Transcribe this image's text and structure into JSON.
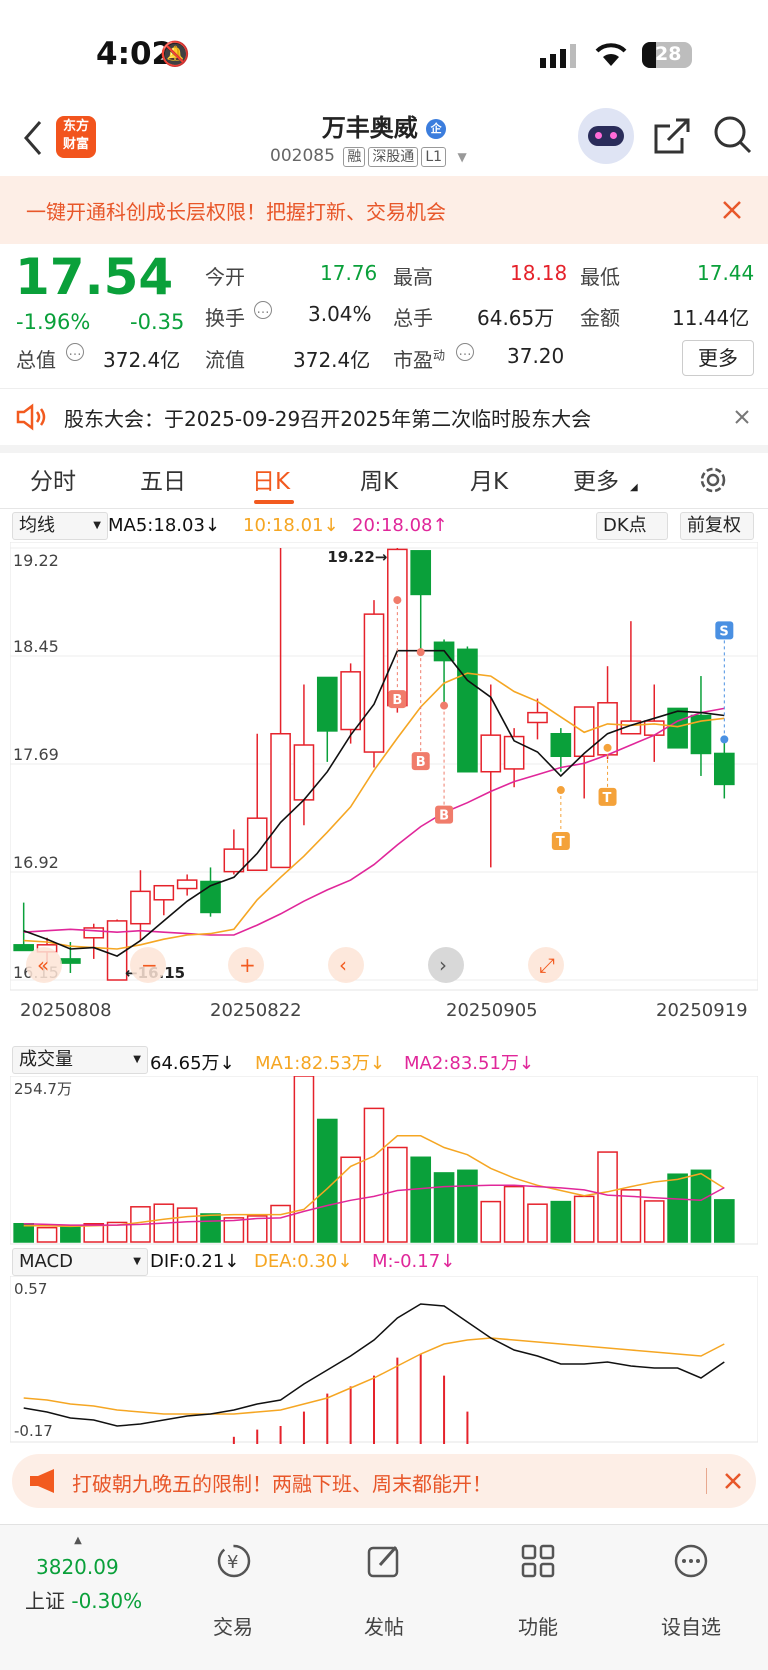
{
  "status_bar": {
    "time": "4:02",
    "battery": "28"
  },
  "header": {
    "title": "万丰奥威",
    "badge": "企",
    "code": "002085",
    "tags": [
      "融",
      "深股通",
      "L1"
    ],
    "logo_line1": "东方",
    "logo_line2": "财富"
  },
  "promo_banner": {
    "text": "一键开通科创成长层权限！把握打新、交易机会"
  },
  "quote": {
    "price": "17.54",
    "change_pct": "-1.96%",
    "change": "-0.35",
    "open_label": "今开",
    "open": "17.76",
    "high_label": "最高",
    "high": "18.18",
    "low_label": "最低",
    "low": "17.44",
    "turnover_label": "换手",
    "turnover": "3.04%",
    "volume_label": "总手",
    "volume": "64.65万",
    "amount_label": "金额",
    "amount": "11.44亿",
    "mcap_label": "总值",
    "mcap": "372.4亿",
    "float_label": "流值",
    "float": "372.4亿",
    "pe_label": "市盈",
    "pe_sup": "动",
    "pe": "37.20",
    "more": "更多"
  },
  "notice": {
    "text": "股东大会：于2025-09-29召开2025年第二次临时股东大会"
  },
  "tabs": [
    "分时",
    "五日",
    "日K",
    "周K",
    "月K",
    "更多"
  ],
  "active_tab": 2,
  "kline": {
    "ma_selector": "均线",
    "ma5": "MA5:18.03",
    "ma10": "10:18.01",
    "ma20": "20:18.08",
    "dk": "DK点",
    "fq": "前复权",
    "price_labels": [
      "19.22",
      "18.45",
      "17.69",
      "16.92",
      "16.15"
    ],
    "high_annot": "19.22",
    "low_annot": "16.15",
    "dates": [
      "20250808",
      "20250822",
      "20250905",
      "20250919"
    ],
    "signals": {
      "buy": "B",
      "sell": "S",
      "t": "T"
    }
  },
  "volume": {
    "selector": "成交量",
    "value": "64.65万",
    "ma1": "MA1:82.53万",
    "ma2": "MA2:83.51万",
    "max_label": "254.7万"
  },
  "macd": {
    "selector": "MACD",
    "dif": "DIF:0.21",
    "dea": "DEA:0.30",
    "m": "M:-0.17",
    "top_label": "0.57",
    "bottom_label": "-0.17"
  },
  "chart_data": {
    "type": "candlestick",
    "x": [
      "0808",
      "0811",
      "0812",
      "0813",
      "0814",
      "0815",
      "0818",
      "0819",
      "0820",
      "0821",
      "0822",
      "0825",
      "0826",
      "0827",
      "0828",
      "0829",
      "0901",
      "0902",
      "0903",
      "0904",
      "0905",
      "0908",
      "0909",
      "0910",
      "0911",
      "0912",
      "0915",
      "0916",
      "0917",
      "0918",
      "0919"
    ],
    "open": [
      16.4,
      16.35,
      16.3,
      16.45,
      16.15,
      16.55,
      16.72,
      16.8,
      16.85,
      16.92,
      16.93,
      16.95,
      17.43,
      18.3,
      17.93,
      17.77,
      18.1,
      19.2,
      18.55,
      18.5,
      17.63,
      17.65,
      17.98,
      17.9,
      17.74,
      17.75,
      17.9,
      17.89,
      18.08,
      18.03,
      17.76
    ],
    "close": [
      16.36,
      16.4,
      16.27,
      16.52,
      16.57,
      16.78,
      16.82,
      16.86,
      16.63,
      17.08,
      17.3,
      17.9,
      17.82,
      17.92,
      18.34,
      18.75,
      19.21,
      18.89,
      18.42,
      17.63,
      17.89,
      17.88,
      18.05,
      17.74,
      18.09,
      18.12,
      17.99,
      17.99,
      17.8,
      17.76,
      17.54
    ],
    "high": [
      16.7,
      16.45,
      16.42,
      16.55,
      16.58,
      16.93,
      16.82,
      16.9,
      16.95,
      17.22,
      17.9,
      19.22,
      18.25,
      18.18,
      18.4,
      18.85,
      19.22,
      19.08,
      18.57,
      18.52,
      18.25,
      17.94,
      18.15,
      17.94,
      18.05,
      18.38,
      18.7,
      18.25,
      18.05,
      18.31,
      17.86
    ],
    "low": [
      16.36,
      16.28,
      16.2,
      16.3,
      16.15,
      16.43,
      16.61,
      16.75,
      16.6,
      16.9,
      16.93,
      16.95,
      17.25,
      17.7,
      17.83,
      17.66,
      18.05,
      18.48,
      18.1,
      17.63,
      16.95,
      17.52,
      17.86,
      17.63,
      17.44,
      17.72,
      17.91,
      17.7,
      17.8,
      17.6,
      17.44
    ],
    "ma5": [
      16.5,
      16.44,
      16.37,
      16.38,
      16.32,
      16.43,
      16.57,
      16.71,
      16.82,
      16.88,
      17.05,
      17.27,
      17.43,
      17.63,
      17.89,
      18.11,
      18.49,
      18.49,
      18.49,
      18.28,
      18.16,
      17.85,
      17.77,
      17.6,
      17.76,
      17.9,
      17.96,
      18.01,
      18.06,
      18.05,
      18.03
    ],
    "ma10": [
      16.43,
      16.42,
      16.39,
      16.38,
      16.37,
      16.4,
      16.44,
      16.47,
      16.48,
      16.51,
      16.72,
      16.88,
      17.03,
      17.2,
      17.38,
      17.64,
      17.87,
      18.09,
      18.26,
      18.33,
      18.31,
      18.2,
      18.13,
      18.02,
      17.91,
      17.97,
      17.96,
      17.97,
      17.95,
      17.99,
      18.01
    ],
    "ma20": [
      16.49,
      16.5,
      16.51,
      16.5,
      16.49,
      16.5,
      16.49,
      16.48,
      16.47,
      16.47,
      16.54,
      16.62,
      16.71,
      16.79,
      16.86,
      16.97,
      17.11,
      17.24,
      17.34,
      17.41,
      17.49,
      17.56,
      17.61,
      17.66,
      17.69,
      17.75,
      17.82,
      17.89,
      17.99,
      18.05,
      18.08
    ],
    "volume_wan": [
      28,
      22,
      24,
      28,
      30,
      54,
      58,
      52,
      43,
      37,
      40,
      56,
      254.7,
      188,
      130,
      205,
      145,
      130,
      106,
      110,
      62,
      85,
      58,
      62,
      70,
      138,
      80,
      63,
      104,
      110,
      64.65
    ],
    "volume_ma1_wan": [
      25,
      25,
      24,
      25,
      26,
      30,
      35,
      39,
      41,
      42,
      42,
      42,
      50,
      82,
      116,
      132,
      163,
      163,
      145,
      134,
      113,
      98,
      87,
      79,
      71,
      77,
      85,
      92,
      96,
      105,
      82.53
    ],
    "volume_ma2_wan": [
      28,
      27,
      26,
      26,
      26,
      27,
      29,
      31,
      32,
      33,
      36,
      37,
      47,
      56,
      64,
      70,
      79,
      82,
      85,
      86,
      87,
      87,
      85,
      83,
      80,
      72,
      70,
      68,
      66,
      64,
      83.51
    ],
    "macd_dif": [
      -0.02,
      -0.04,
      -0.07,
      -0.08,
      -0.11,
      -0.1,
      -0.08,
      -0.06,
      -0.05,
      -0.03,
      0.0,
      0.02,
      0.1,
      0.17,
      0.24,
      0.32,
      0.43,
      0.5,
      0.49,
      0.41,
      0.33,
      0.27,
      0.24,
      0.2,
      0.2,
      0.21,
      0.19,
      0.18,
      0.18,
      0.13,
      0.21
    ],
    "macd_dea": [
      0.03,
      0.02,
      0.0,
      -0.01,
      -0.03,
      -0.04,
      -0.05,
      -0.05,
      -0.05,
      -0.05,
      -0.04,
      -0.03,
      0.0,
      0.03,
      0.08,
      0.13,
      0.19,
      0.25,
      0.3,
      0.32,
      0.33,
      0.32,
      0.31,
      0.3,
      0.29,
      0.28,
      0.27,
      0.26,
      0.25,
      0.24,
      0.3
    ],
    "macd_m": [
      -0.1,
      -0.12,
      -0.14,
      -0.14,
      -0.16,
      -0.12,
      -0.06,
      -0.02,
      0.0,
      0.04,
      0.08,
      0.1,
      0.18,
      0.28,
      0.32,
      0.38,
      0.48,
      0.5,
      0.38,
      0.18,
      0.0,
      -0.06,
      -0.12,
      -0.18,
      -0.18,
      -0.14,
      -0.16,
      -0.16,
      -0.14,
      -0.22,
      -0.17
    ],
    "ylim": [
      16.15,
      19.22
    ],
    "colors": {
      "up": "#e5222b",
      "down": "#0aa03a",
      "ma5": "#111111",
      "ma10": "#f5a623",
      "ma20": "#e0279a"
    }
  },
  "bottom_banner": {
    "text": "打破朝九晚五的限制！两融下班、周末都能开！"
  },
  "tabbar": {
    "index_value": "3820.09",
    "index_name": "上证",
    "index_change": "-0.30%",
    "items": [
      "交易",
      "发帖",
      "功能",
      "设自选"
    ]
  }
}
